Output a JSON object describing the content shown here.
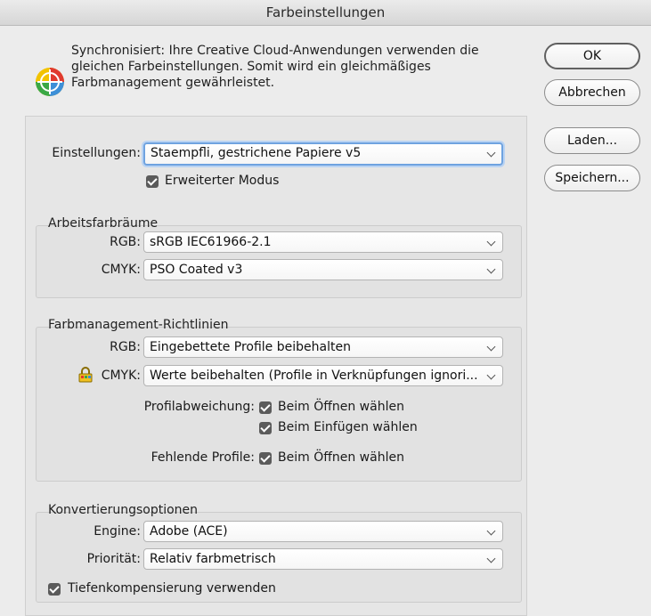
{
  "window": {
    "title": "Farbeinstellungen"
  },
  "sync": {
    "icon": "color-sync-icon",
    "lines": [
      "Synchronisiert: Ihre Creative Cloud-Anwendungen verwenden die",
      "gleichen Farbeinstellungen. Somit wird ein gleichmäßiges",
      "Farbmanagement gewährleistet."
    ]
  },
  "buttons": {
    "ok": "OK",
    "cancel": "Abbrechen",
    "load": "Laden...",
    "save": "Speichern..."
  },
  "settings": {
    "label": "Einstellungen:",
    "value": "Staempfli, gestrichene Papiere v5",
    "advanced_mode": {
      "label": "Erweiterter Modus",
      "checked": true
    }
  },
  "working_spaces": {
    "title": "Arbeitsfarbräume",
    "rgb": {
      "label": "RGB:",
      "value": "sRGB IEC61966-2.1"
    },
    "cmyk": {
      "label": "CMYK:",
      "value": "PSO Coated v3"
    }
  },
  "policies": {
    "title": "Farbmanagement-Richtlinien",
    "rgb": {
      "label": "RGB:",
      "value": "Eingebettete Profile beibehalten"
    },
    "cmyk": {
      "label": "CMYK:",
      "value": "Werte beibehalten (Profile in Verknüpfungen ignori...",
      "icon": "lock-icon"
    },
    "mismatch": {
      "label": "Profilabweichung:",
      "ask_open": {
        "label": "Beim Öffnen wählen",
        "checked": true
      },
      "ask_paste": {
        "label": "Beim Einfügen wählen",
        "checked": true
      }
    },
    "missing": {
      "label": "Fehlende Profile:",
      "ask_open": {
        "label": "Beim Öffnen wählen",
        "checked": true
      }
    }
  },
  "conversion": {
    "title": "Konvertierungsoptionen",
    "engine": {
      "label": "Engine:",
      "value": "Adobe (ACE)"
    },
    "intent": {
      "label": "Priorität:",
      "value": "Relativ farbmetrisch"
    },
    "black_point": {
      "label": "Tiefenkompensierung verwenden",
      "checked": true
    }
  },
  "colors": {
    "focus_ring": "#6fa3e0",
    "checkbox": "#5b5b5b",
    "background": "#ececec"
  }
}
